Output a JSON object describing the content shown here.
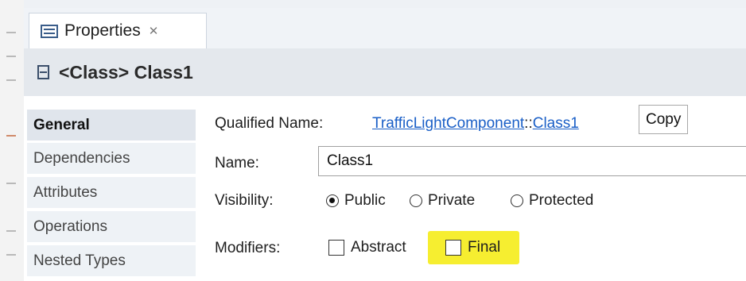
{
  "view": {
    "tab_title": "Properties",
    "tab_icon": "properties-view-icon",
    "close_glyph": "✕"
  },
  "header": {
    "icon": "class-icon",
    "title": "<Class> Class1"
  },
  "sidebar": {
    "items": [
      {
        "label": "General",
        "active": true
      },
      {
        "label": "Dependencies",
        "active": false
      },
      {
        "label": "Attributes",
        "active": false
      },
      {
        "label": "Operations",
        "active": false
      },
      {
        "label": "Nested Types",
        "active": false
      }
    ]
  },
  "general": {
    "qualified_name_label": "Qualified Name:",
    "qualified_name_package": "TrafficLightComponent",
    "qualified_name_separator": "::",
    "qualified_name_class": "Class1",
    "copy_label": "Copy",
    "name_label": "Name:",
    "name_value": "Class1",
    "visibility_label": "Visibility:",
    "visibility_options": [
      "Public",
      "Private",
      "Protected"
    ],
    "visibility_selected": "Public",
    "modifiers_label": "Modifiers:",
    "modifier_abstract": "Abstract",
    "modifier_final": "Final",
    "abstract_checked": false,
    "final_checked": false,
    "highlight_color": "#f6ee30"
  }
}
